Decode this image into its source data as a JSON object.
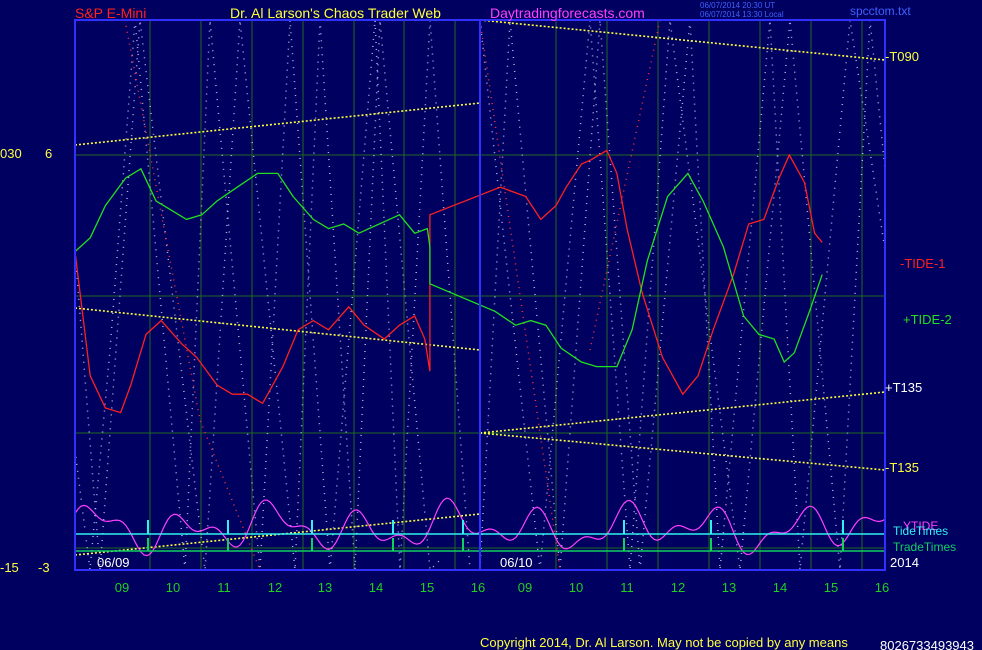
{
  "header": {
    "symbol": "S&P E-Mini",
    "title": "Dr. Al Larson's Chaos Trader Web",
    "site": "Daytradingforecasts.com",
    "timestamp_ut": "06/07/2014 20:30 UT",
    "timestamp_local": "06/07/2014 13:30 Local",
    "file": "spcctom.txt"
  },
  "left_labels": {
    "top_outer": "030",
    "top_inner": "6",
    "bottom_outer": "-15",
    "bottom_inner": "-3"
  },
  "copyright": "Copyright 2014, Dr. Al Larson. May not be copied by any means",
  "code": "8026733493943",
  "colors": {
    "background": "#000060",
    "grid": "#1f6a1f",
    "frame": "#3030ff",
    "tide1": "#ff2020",
    "tide2": "#20e020",
    "ytide": "#ff40ff",
    "tidetimes": "#30f0f0",
    "tradetimes": "#10d060",
    "hour_label": "#20d020",
    "yellow": "#ffff40",
    "dots_white": "#cfd0ff",
    "dots_red": "#ff3030"
  },
  "chart_data": {
    "type": "line",
    "x_axis": {
      "date_labels": [
        "06/09",
        "06/10",
        "2014"
      ],
      "day1_hours": [
        "09",
        "10",
        "11",
        "12",
        "13",
        "14",
        "15",
        "16"
      ],
      "day2_hours": [
        "09",
        "10",
        "11",
        "12",
        "13",
        "14",
        "15",
        "16"
      ]
    },
    "y_scale": {
      "inner_top": 6,
      "inner_bottom": -3,
      "outer_top": 30,
      "outer_bottom": -15
    },
    "series": [
      {
        "name": "-TIDE-1",
        "color": "#ff2020",
        "points": [
          [
            9.0,
            3.9
          ],
          [
            9.3,
            1.2
          ],
          [
            9.6,
            0.5
          ],
          [
            9.9,
            0.4
          ],
          [
            10.1,
            1.0
          ],
          [
            10.4,
            2.1
          ],
          [
            10.7,
            2.4
          ],
          [
            11.1,
            1.9
          ],
          [
            11.4,
            1.6
          ],
          [
            11.8,
            1.0
          ],
          [
            12.1,
            0.8
          ],
          [
            12.4,
            0.8
          ],
          [
            12.7,
            0.6
          ],
          [
            13.1,
            1.4
          ],
          [
            13.4,
            2.2
          ],
          [
            13.7,
            2.4
          ],
          [
            14.0,
            2.2
          ],
          [
            14.4,
            2.7
          ],
          [
            14.7,
            2.3
          ],
          [
            15.1,
            2.0
          ],
          [
            15.4,
            2.3
          ],
          [
            15.7,
            2.5
          ],
          [
            15.9,
            2.0
          ],
          [
            16.0,
            1.3
          ],
          [
            16.0,
            4.7
          ],
          [
            16.4,
            5.3
          ],
          [
            16.9,
            5.1
          ],
          [
            17.2,
            4.6
          ],
          [
            17.5,
            4.9
          ],
          [
            17.7,
            5.3
          ],
          [
            18.0,
            5.8
          ],
          [
            18.2,
            5.9
          ],
          [
            18.5,
            6.1
          ],
          [
            18.7,
            5.6
          ],
          [
            18.9,
            4.4
          ],
          [
            19.2,
            3.0
          ],
          [
            19.6,
            1.6
          ],
          [
            20.0,
            0.8
          ],
          [
            20.3,
            1.2
          ],
          [
            20.6,
            2.2
          ],
          [
            21.0,
            3.4
          ],
          [
            21.3,
            4.5
          ],
          [
            21.6,
            4.6
          ],
          [
            21.9,
            5.5
          ],
          [
            22.1,
            6.0
          ],
          [
            22.4,
            5.4
          ],
          [
            22.6,
            4.3
          ],
          [
            22.75,
            4.1
          ]
        ]
      },
      {
        "name": "+TIDE-2",
        "color": "#20e020",
        "points": [
          [
            9.0,
            3.9
          ],
          [
            9.3,
            4.2
          ],
          [
            9.6,
            4.9
          ],
          [
            10.0,
            5.5
          ],
          [
            10.3,
            5.7
          ],
          [
            10.6,
            5.0
          ],
          [
            10.9,
            4.8
          ],
          [
            11.2,
            4.6
          ],
          [
            11.5,
            4.7
          ],
          [
            11.8,
            5.0
          ],
          [
            12.2,
            5.3
          ],
          [
            12.6,
            5.6
          ],
          [
            13.0,
            5.6
          ],
          [
            13.3,
            5.1
          ],
          [
            13.7,
            4.6
          ],
          [
            14.0,
            4.4
          ],
          [
            14.3,
            4.5
          ],
          [
            14.6,
            4.3
          ],
          [
            15.0,
            4.5
          ],
          [
            15.4,
            4.7
          ],
          [
            15.7,
            4.3
          ],
          [
            15.95,
            4.4
          ],
          [
            16.0,
            4.0
          ],
          [
            16.0,
            3.2
          ],
          [
            16.3,
            2.6
          ],
          [
            16.7,
            2.3
          ],
          [
            17.0,
            2.4
          ],
          [
            17.3,
            2.3
          ],
          [
            17.6,
            1.8
          ],
          [
            18.0,
            1.5
          ],
          [
            18.3,
            1.4
          ],
          [
            18.7,
            1.4
          ],
          [
            19.0,
            2.2
          ],
          [
            19.3,
            3.7
          ],
          [
            19.7,
            5.1
          ],
          [
            20.1,
            5.6
          ],
          [
            20.4,
            5.0
          ],
          [
            20.8,
            4.0
          ],
          [
            21.2,
            2.5
          ],
          [
            21.5,
            2.1
          ],
          [
            21.8,
            2.0
          ],
          [
            22.0,
            1.5
          ],
          [
            22.2,
            1.7
          ],
          [
            22.5,
            2.6
          ],
          [
            22.75,
            3.4
          ]
        ]
      }
    ],
    "annotations": [
      "-T090",
      "-TIDE-1",
      "+TIDE-2",
      "+T135",
      "-T135",
      "YTIDE",
      "TideTimes",
      "TradeTimes"
    ]
  }
}
